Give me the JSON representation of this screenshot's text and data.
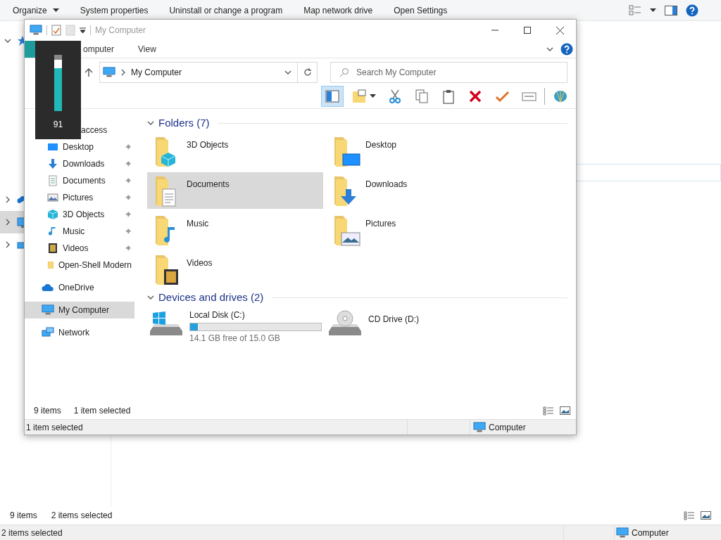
{
  "background": {
    "toolbar": [
      "Organize",
      "System properties",
      "Uninstall or change a program",
      "Map network drive",
      "Open Settings"
    ],
    "nav_rows": [
      {
        "expanded": true,
        "selected": false
      },
      {
        "expanded": false,
        "selected": false
      },
      {
        "expanded": false,
        "selected": true
      },
      {
        "expanded": false,
        "selected": false
      }
    ],
    "status_row": {
      "items": "9 items",
      "selection": "2 items selected"
    },
    "status_bar": {
      "text": "2 items selected",
      "location": "Computer"
    }
  },
  "window": {
    "title": "My Computer",
    "tabs": [
      {
        "selected": true
      },
      {
        "label": "omputer",
        "selected": false
      },
      {
        "label": "View",
        "selected": false
      }
    ],
    "address": "My Computer",
    "search": {
      "placeholder": "Search My Computer"
    },
    "toolbar": [
      {
        "selected": true
      },
      {
        "selected": false
      },
      {
        "selected": false
      },
      {
        "selected": false
      },
      {
        "selected": false
      },
      {
        "selected": false
      },
      {
        "selected": false
      },
      {
        "selected": false
      },
      {
        "selected": false
      }
    ],
    "nav": [
      {
        "label": "access",
        "selected": false,
        "children": [
          {
            "label": "Desktop",
            "pinned": true
          },
          {
            "label": "Downloads",
            "pinned": true
          },
          {
            "label": "Documents",
            "pinned": true
          },
          {
            "label": "Pictures",
            "pinned": true
          },
          {
            "label": "3D Objects",
            "pinned": true
          },
          {
            "label": "Music",
            "pinned": true
          },
          {
            "label": "Videos",
            "pinned": true
          },
          {
            "label": "Open-Shell Modern",
            "pinned": false
          }
        ]
      },
      {
        "label": "OneDrive",
        "selected": false
      },
      {
        "label": "My Computer",
        "selected": true
      },
      {
        "label": "Network",
        "selected": false
      }
    ],
    "groups": [
      {
        "title": "Folders (7)",
        "items": [
          {
            "name": "3D Objects",
            "selected": false
          },
          {
            "name": "Desktop",
            "selected": false
          },
          {
            "name": "Documents",
            "selected": true
          },
          {
            "name": "Downloads",
            "selected": false
          },
          {
            "name": "Music",
            "selected": false
          },
          {
            "name": "Pictures",
            "selected": false
          },
          {
            "name": "Videos",
            "selected": false
          }
        ]
      },
      {
        "title": "Devices and drives (2)",
        "drives": [
          {
            "name": "Local Disk (C:)",
            "level": 0.06,
            "free": "14.1 GB free of 15.0 GB"
          },
          {
            "name": "CD Drive (D:)"
          }
        ]
      }
    ],
    "status_row": {
      "items": "9 items",
      "selection": "1 item selected"
    },
    "status_bar": {
      "text": "1 item selected",
      "location": "Computer"
    }
  },
  "volume_overlay": {
    "level": 0.91,
    "reading": "91"
  }
}
